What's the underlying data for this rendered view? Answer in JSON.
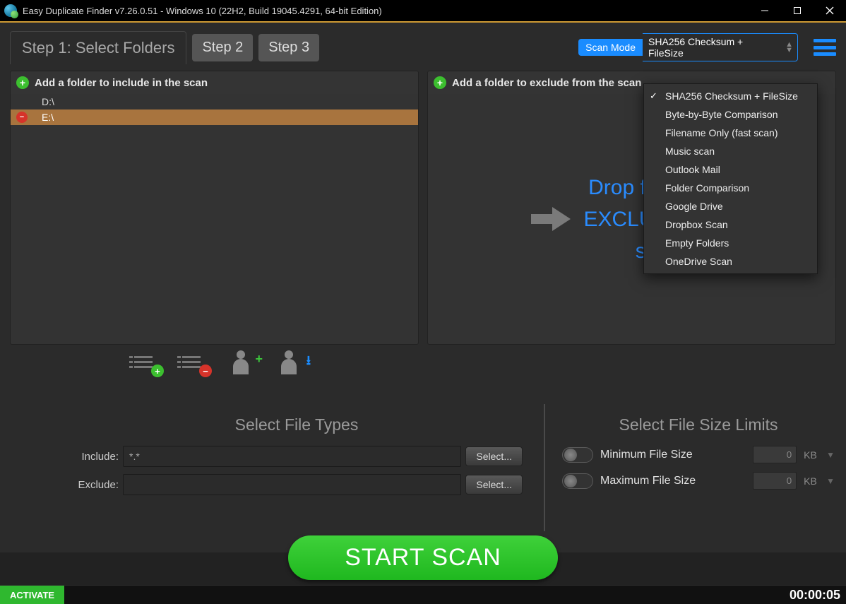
{
  "title": "Easy Duplicate Finder v7.26.0.51 - Windows 10 (22H2, Build 19045.4291, 64-bit Edition)",
  "steps": {
    "s1": "Step 1: Select Folders",
    "s2": "Step 2",
    "s3": "Step 3"
  },
  "scan_mode": {
    "label": "Scan Mode",
    "selected": "SHA256 Checksum + FileSize"
  },
  "dropdown_items": [
    {
      "label": "SHA256 Checksum + FileSize",
      "checked": true
    },
    {
      "label": "Byte-by-Byte Comparison",
      "checked": false
    },
    {
      "label": "Filename Only (fast scan)",
      "checked": false
    },
    {
      "label": "Music scan",
      "checked": false
    },
    {
      "label": "Outlook Mail",
      "checked": false
    },
    {
      "label": "Folder Comparison",
      "checked": false
    },
    {
      "label": "Google Drive",
      "checked": false
    },
    {
      "label": "Dropbox Scan",
      "checked": false
    },
    {
      "label": "Empty Folders",
      "checked": false
    },
    {
      "label": "OneDrive Scan",
      "checked": false
    }
  ],
  "include_panel": {
    "header": "Add a folder to include in the scan",
    "folders": [
      {
        "path": "D:\\",
        "selected": false
      },
      {
        "path": "E:\\",
        "selected": true
      }
    ]
  },
  "exclude_panel": {
    "header": "Add a folder to exclude from the scan",
    "drop_text": "Drop folders to\nEXCLUDE from\nscan"
  },
  "filetypes": {
    "title": "Select File Types",
    "include_label": "Include:",
    "include_value": "*.*",
    "exclude_label": "Exclude:",
    "exclude_value": "",
    "select_btn": "Select..."
  },
  "sizelimits": {
    "title": "Select File Size Limits",
    "min_label": "Minimum File Size",
    "min_value": "0",
    "max_label": "Maximum File Size",
    "max_value": "0",
    "unit": "KB"
  },
  "start_btn": "START SCAN",
  "activate": "ACTIVATE",
  "timer": "00:00:05"
}
